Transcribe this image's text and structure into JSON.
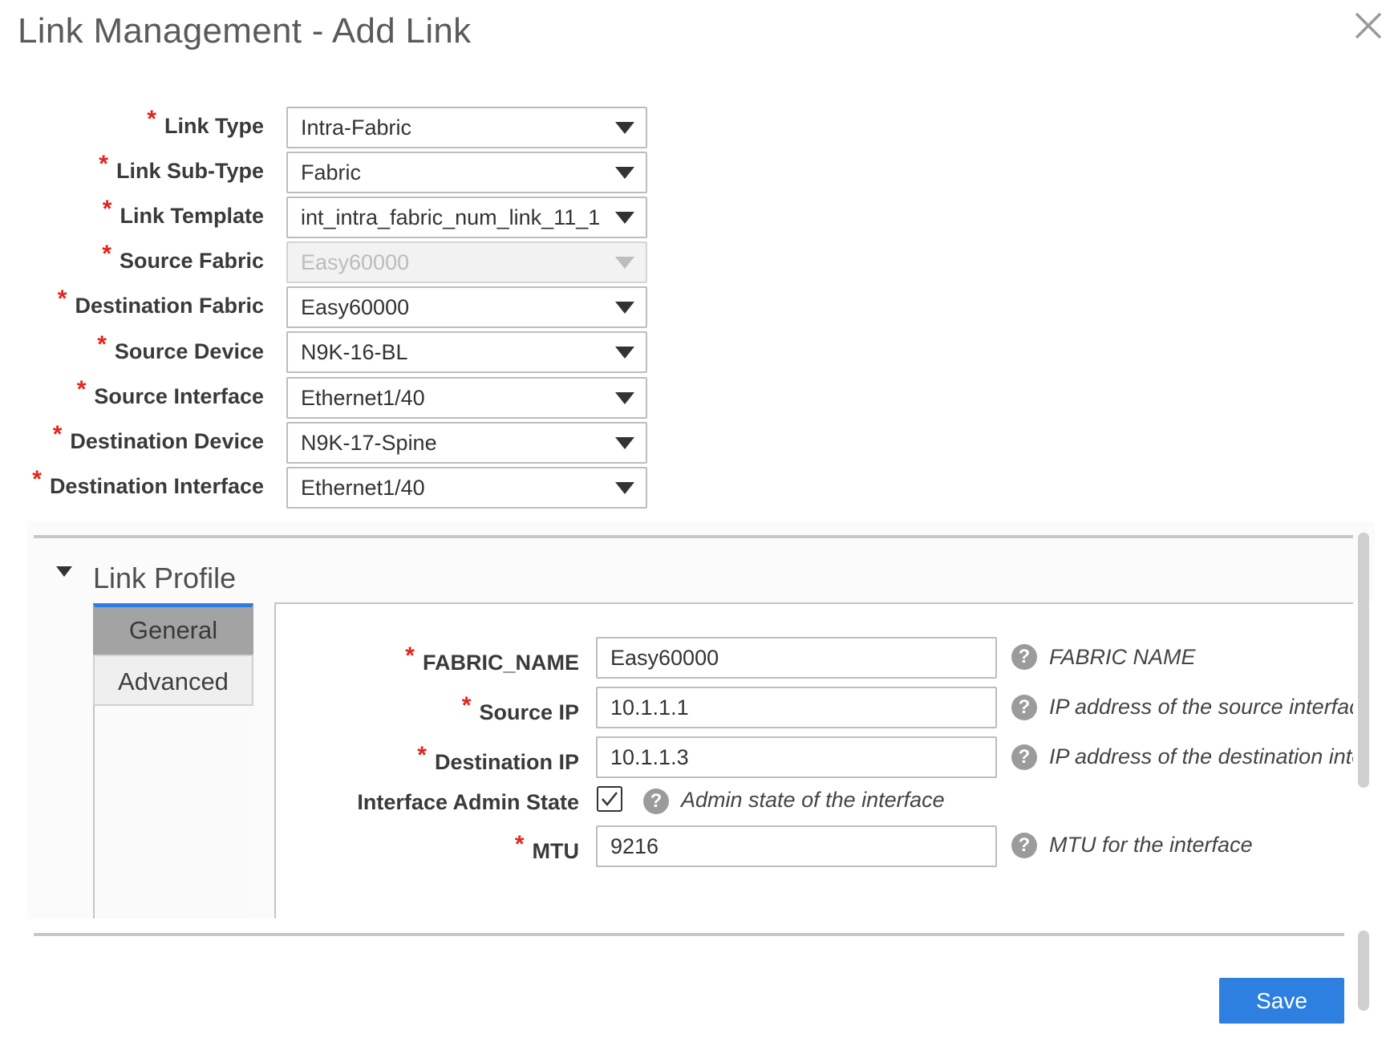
{
  "dialog": {
    "title": "Link Management - Add Link",
    "close_icon": "close-icon"
  },
  "form": {
    "required_mark": "*",
    "fields": [
      {
        "label": "Link Type",
        "value": "Intra-Fabric"
      },
      {
        "label": "Link Sub-Type",
        "value": "Fabric"
      },
      {
        "label": "Link Template",
        "value": "int_intra_fabric_num_link_11_1"
      },
      {
        "label": "Source Fabric",
        "value": "Easy60000",
        "disabled": true
      },
      {
        "label": "Destination Fabric",
        "value": "Easy60000"
      },
      {
        "label": "Source Device",
        "value": "N9K-16-BL"
      },
      {
        "label": "Source Interface",
        "value": "Ethernet1/40"
      },
      {
        "label": "Destination Device",
        "value": "N9K-17-Spine"
      },
      {
        "label": "Destination Interface",
        "value": "Ethernet1/40"
      }
    ]
  },
  "link_profile": {
    "title": "Link Profile",
    "tabs": [
      {
        "label": "General",
        "active": true
      },
      {
        "label": "Advanced",
        "active": false
      }
    ],
    "help_glyph": "?",
    "fields": [
      {
        "label": "FABRIC_NAME",
        "required": true,
        "value": "Easy60000",
        "help": "FABRIC NAME"
      },
      {
        "label": "Source IP",
        "required": true,
        "value": "10.1.1.1",
        "help": "IP address of the source interface"
      },
      {
        "label": "Destination IP",
        "required": true,
        "value": "10.1.1.3",
        "help": "IP address of the destination interface"
      },
      {
        "label": "Interface Admin State",
        "required": false,
        "checked": true,
        "help": "Admin state of the interface"
      },
      {
        "label": "MTU",
        "required": true,
        "value": "9216",
        "help": "MTU for the interface"
      }
    ]
  },
  "footer": {
    "save_label": "Save"
  },
  "colors": {
    "accent": "#2d7fe0",
    "required": "#e3241b"
  }
}
